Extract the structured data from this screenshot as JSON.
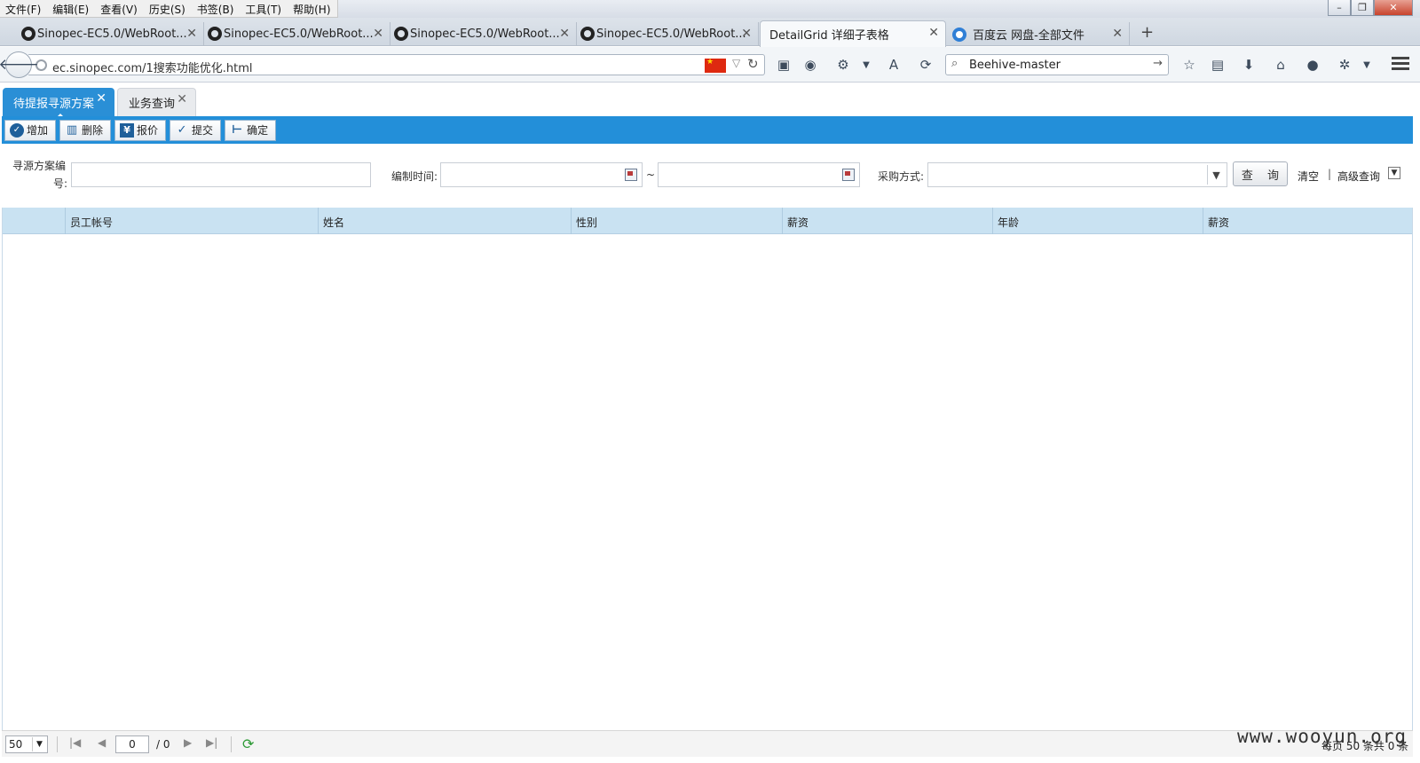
{
  "menu": [
    "文件(F)",
    "编辑(E)",
    "查看(V)",
    "历史(S)",
    "书签(B)",
    "工具(T)",
    "帮助(H)"
  ],
  "window_controls": {
    "minimize": "–",
    "restore": "❐",
    "close": "✕"
  },
  "browser_tabs": [
    {
      "title": "Sinopec-EC5.0/WebRoot...",
      "icon": "github-icon"
    },
    {
      "title": "Sinopec-EC5.0/WebRoot...",
      "icon": "github-icon"
    },
    {
      "title": "Sinopec-EC5.0/WebRoot...",
      "icon": "github-icon"
    },
    {
      "title": "Sinopec-EC5.0/WebRoot...",
      "icon": "github-icon"
    },
    {
      "title": "DetailGrid 详细子表格",
      "icon": "",
      "active": true
    },
    {
      "title": "百度云 网盘-全部文件",
      "icon": "baidu-cloud-icon"
    }
  ],
  "tab_close": "✕",
  "new_tab": "+",
  "navbar": {
    "url": "ec.sinopec.com/1搜索功能优化.html",
    "search": "Beehive-master"
  },
  "page_tabs": [
    {
      "label": "待提报寻源方案",
      "active": true
    },
    {
      "label": "业务查询",
      "active": false
    }
  ],
  "toolbar": [
    {
      "label": "增加",
      "icon": "add-icon",
      "glyph": "✓"
    },
    {
      "label": "删除",
      "icon": "delete-icon",
      "glyph": "🗑"
    },
    {
      "label": "报价",
      "icon": "quote-icon",
      "glyph": "¥"
    },
    {
      "label": "提交",
      "icon": "submit-icon",
      "glyph": "✓"
    },
    {
      "label": "确定",
      "icon": "confirm-icon",
      "glyph": "⊢"
    }
  ],
  "form": {
    "plan_no_label_line1": "寻源方案编",
    "plan_no_label_line2": "号:",
    "plan_no_value": "",
    "date_label": "编制时间:",
    "date_from": "",
    "date_sep": "~",
    "date_to": "",
    "purchase_label": "采购方式:",
    "purchase_value": "",
    "query_button": "查 询",
    "clear_link": "清空",
    "link_sep": "|",
    "advanced_link": "高级查询"
  },
  "grid": {
    "columns": [
      "员工帐号",
      "姓名",
      "性别",
      "薪资",
      "年龄",
      "薪资"
    ],
    "rows": []
  },
  "pager": {
    "page_size": "50",
    "current_page": "0",
    "total_pages": "/ 0",
    "info": "每页 50 条共 0 条"
  },
  "watermark": "www.wooyun.org"
}
